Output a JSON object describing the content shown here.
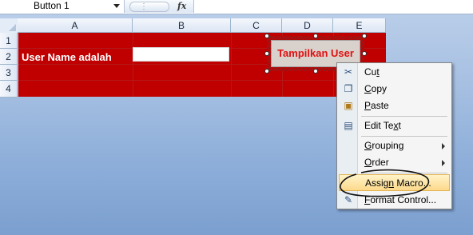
{
  "formula_bar": {
    "name_box": "Button 1",
    "fx_label": "fx"
  },
  "sheet": {
    "columns": [
      "A",
      "B",
      "C",
      "D",
      "E"
    ],
    "rows": [
      "1",
      "2",
      "3",
      "4"
    ],
    "cells": {
      "a2_label": "User Name adalah",
      "b2_value": ""
    },
    "button": {
      "label": "Tampilkan User"
    }
  },
  "context_menu": {
    "items": [
      {
        "id": "cut",
        "pre": "Cu",
        "ul": "t",
        "post": "",
        "icon": "scissors-icon"
      },
      {
        "id": "copy",
        "pre": "",
        "ul": "C",
        "post": "opy",
        "icon": "copy-icon"
      },
      {
        "id": "paste",
        "pre": "",
        "ul": "P",
        "post": "aste",
        "icon": "paste-icon"
      },
      {
        "id": "edit-text",
        "pre": "Edit Te",
        "ul": "x",
        "post": "t",
        "icon": "edit-text-icon"
      },
      {
        "id": "grouping",
        "pre": "",
        "ul": "G",
        "post": "rouping",
        "icon": ""
      },
      {
        "id": "order",
        "pre": "",
        "ul": "O",
        "post": "rder",
        "icon": ""
      },
      {
        "id": "assign-macro",
        "pre": "Assig",
        "ul": "n",
        "post": " Macro...",
        "icon": ""
      },
      {
        "id": "format-control",
        "pre": "",
        "ul": "F",
        "post": "ormat Control...",
        "icon": "format-control-icon"
      }
    ]
  },
  "colors": {
    "sheet_red": "#c00000",
    "button_text": "#e01010",
    "highlight": "#fdd98a"
  }
}
